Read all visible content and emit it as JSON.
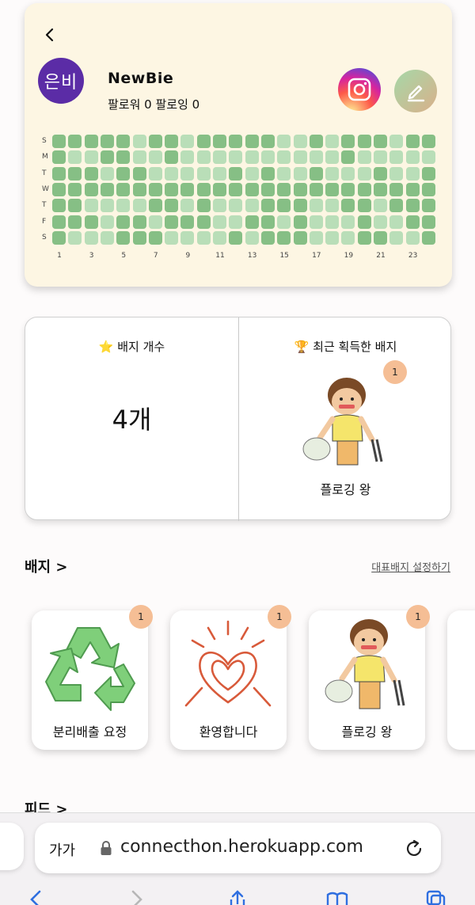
{
  "profile": {
    "avatar_text": "은비",
    "username": "NewBie",
    "follow_info": "팔로워 0 팔로잉 0"
  },
  "heatmap": {
    "day_labels": [
      "S",
      "M",
      "T",
      "W",
      "T",
      "F",
      "S"
    ],
    "week_labels": [
      "1",
      "3",
      "5",
      "7",
      "9",
      "11",
      "13",
      "15",
      "17",
      "19",
      "21",
      "23"
    ],
    "colors": {
      "dark": "#86bf85",
      "light": "#b9deb8"
    },
    "levels": [
      [
        2,
        2,
        2,
        2,
        2,
        1,
        2,
        2,
        1,
        2,
        2,
        2,
        2,
        2,
        1,
        1,
        2,
        1,
        2,
        2,
        2,
        1,
        2,
        2
      ],
      [
        2,
        1,
        1,
        2,
        2,
        1,
        1,
        2,
        1,
        1,
        1,
        1,
        1,
        1,
        1,
        1,
        1,
        1,
        2,
        1,
        1,
        1,
        1,
        1
      ],
      [
        2,
        2,
        2,
        1,
        2,
        2,
        1,
        1,
        1,
        1,
        1,
        2,
        1,
        2,
        1,
        1,
        2,
        1,
        1,
        1,
        2,
        1,
        1,
        2
      ],
      [
        2,
        2,
        2,
        2,
        2,
        2,
        2,
        2,
        2,
        2,
        2,
        2,
        2,
        2,
        2,
        2,
        2,
        2,
        2,
        2,
        2,
        2,
        2,
        2
      ],
      [
        2,
        2,
        1,
        1,
        1,
        1,
        2,
        2,
        1,
        2,
        1,
        1,
        1,
        2,
        2,
        2,
        1,
        1,
        2,
        2,
        1,
        2,
        2,
        2
      ],
      [
        2,
        2,
        2,
        1,
        2,
        2,
        1,
        2,
        2,
        2,
        1,
        1,
        2,
        2,
        1,
        2,
        1,
        1,
        1,
        2,
        1,
        1,
        2,
        2
      ],
      [
        2,
        1,
        1,
        1,
        2,
        2,
        2,
        1,
        1,
        1,
        1,
        2,
        1,
        2,
        2,
        2,
        1,
        1,
        1,
        2,
        2,
        1,
        1,
        2
      ]
    ]
  },
  "stats": {
    "badge_count_title": "⭐ 배지 개수",
    "badge_count_value": "4개",
    "recent_badge_title": "🏆 최근 획득한 배지",
    "recent_badge_count": "1",
    "recent_badge_name": "플로깅 왕"
  },
  "badges_section": {
    "title": "배지 >",
    "set_representative": "대표배지 설정하기",
    "items": [
      {
        "name": "분리배출 요정",
        "count": "1",
        "icon": "recycle-icon"
      },
      {
        "name": "환영합니다",
        "count": "1",
        "icon": "heart-hands-icon"
      },
      {
        "name": "플로깅 왕",
        "count": "1",
        "icon": "plogging-character-icon"
      }
    ]
  },
  "feed_section": {
    "title": "피드 >"
  },
  "browser": {
    "text_size": "가가",
    "url": "connecthon.herokuapp.com"
  }
}
